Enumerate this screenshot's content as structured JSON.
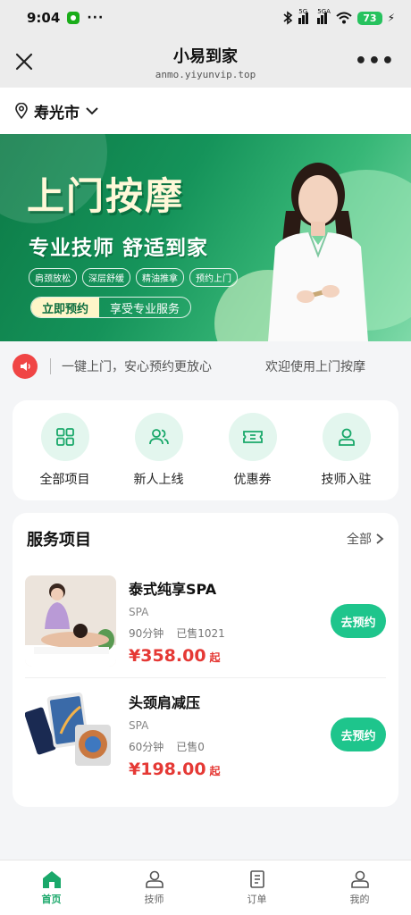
{
  "status_bar": {
    "time": "9:04",
    "battery": "73",
    "signal1": "5G",
    "signal2": "5GA"
  },
  "header": {
    "title": "小易到家",
    "subtitle": "anmo.yiyunvip.top"
  },
  "location": {
    "city": "寿光市"
  },
  "banner": {
    "headline": "上门按摩",
    "subline": "专业技师  舒适到家",
    "tags": [
      "肩颈放松",
      "深层舒缓",
      "精油推拿",
      "预约上门"
    ],
    "cta_button": "立即预约",
    "cta_text": "享受专业服务"
  },
  "notice": {
    "messages": [
      "一键上门，安心预约更放心",
      "欢迎使用上门按摩"
    ]
  },
  "quick_actions": [
    {
      "label": "全部项目",
      "icon": "grid-icon"
    },
    {
      "label": "新人上线",
      "icon": "users-icon"
    },
    {
      "label": "优惠券",
      "icon": "ticket-icon"
    },
    {
      "label": "技师入驻",
      "icon": "user-icon"
    }
  ],
  "services": {
    "title": "服务项目",
    "all_label": "全部",
    "items": [
      {
        "name": "泰式纯享SPA",
        "category": "SPA",
        "duration": "90分钟",
        "sold": "已售1021",
        "price": "¥358.00",
        "price_suffix": "起",
        "button": "去预约"
      },
      {
        "name": "头颈肩减压",
        "category": "SPA",
        "duration": "60分钟",
        "sold": "已售0",
        "price": "¥198.00",
        "price_suffix": "起",
        "button": "去预约"
      }
    ]
  },
  "tabbar": [
    {
      "label": "首页",
      "icon": "home-icon",
      "active": true
    },
    {
      "label": "技师",
      "icon": "technician-icon"
    },
    {
      "label": "订单",
      "icon": "order-icon"
    },
    {
      "label": "我的",
      "icon": "profile-icon"
    }
  ],
  "colors": {
    "accent": "#1ec58c",
    "price": "#e53935",
    "banner": "#15935a",
    "speaker": "#f04545"
  }
}
